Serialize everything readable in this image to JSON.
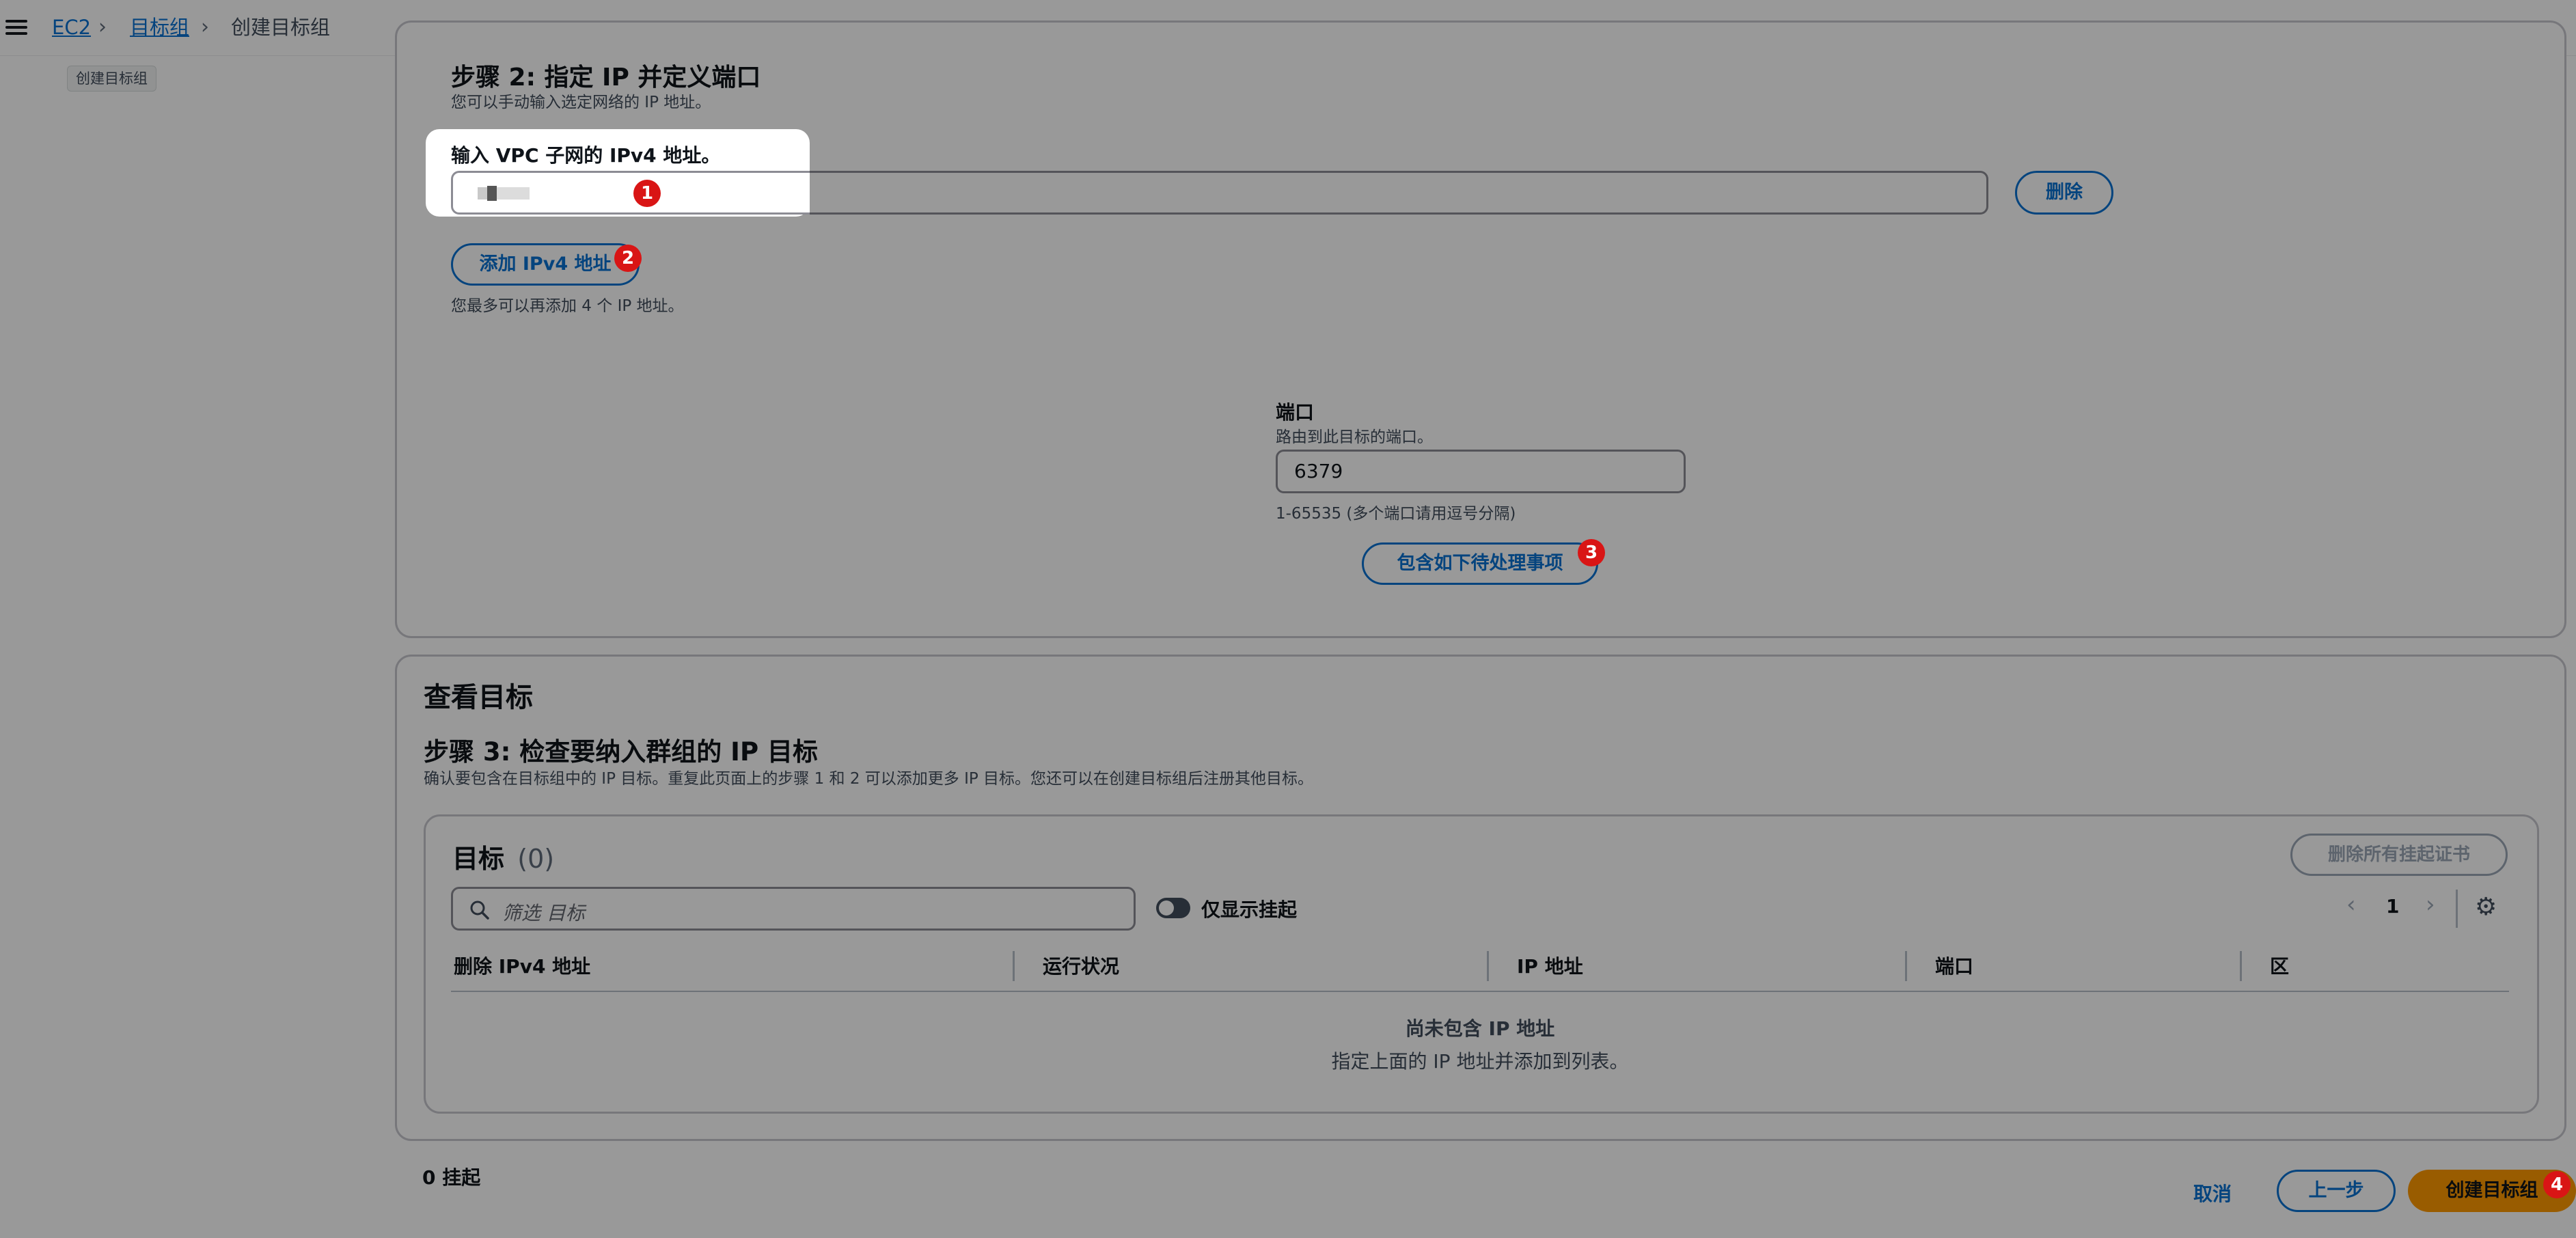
{
  "breadcrumb": {
    "ec2": "EC2",
    "target_groups": "目标组",
    "current": "创建目标组"
  },
  "tooltip": "创建目标组",
  "step2": {
    "title": "步骤 2: 指定 IP 并定义端口",
    "description": "您可以手动输入选定网络的 IP 地址。",
    "ip_label": "输入 VPC 子网的 IPv4 地址。",
    "ip_value": "",
    "remove_button": "删除",
    "add_ipv4_button": "添加 IPv4 地址",
    "add_hint": "您最多可以再添加 4 个 IP 地址。",
    "port_label": "端口",
    "port_description": "路由到此目标的端口。",
    "port_value": "6379",
    "port_constraint": "1-65535 (多个端口请用逗号分隔)",
    "include_pending_button": "包含如下待处理事项"
  },
  "review": {
    "title": "查看目标",
    "step3_title": "步骤 3: 检查要纳入群组的 IP 目标",
    "step3_description": "确认要包含在目标组中的 IP 目标。重复此页面上的步骤 1 和 2 可以添加更多 IP 目标。您还可以在创建目标组后注册其他目标。",
    "targets_title": "目标",
    "targets_count": "(0)",
    "remove_all_pending_button": "删除所有挂起证书",
    "filter_placeholder": "筛选 目标",
    "show_pending_only_label": "仅显示挂起",
    "show_pending_only_checked": false,
    "page_number": "1",
    "columns": [
      "删除 IPv4 地址",
      "运行状况",
      "IP 地址",
      "端口",
      "区"
    ],
    "empty_title": "尚未包含 IP 地址",
    "empty_description": "指定上面的 IP 地址并添加到列表。"
  },
  "footer": {
    "pending_count": "0 挂起",
    "cancel_button": "取消",
    "previous_button": "上一步",
    "create_button": "创建目标组"
  },
  "annotations": [
    "1",
    "2",
    "3",
    "4"
  ],
  "colors": {
    "link": "#0972d3",
    "primary_button": "#ff9900",
    "badge": "#d91515",
    "overlay": "rgba(0,0,0,0.40)"
  }
}
